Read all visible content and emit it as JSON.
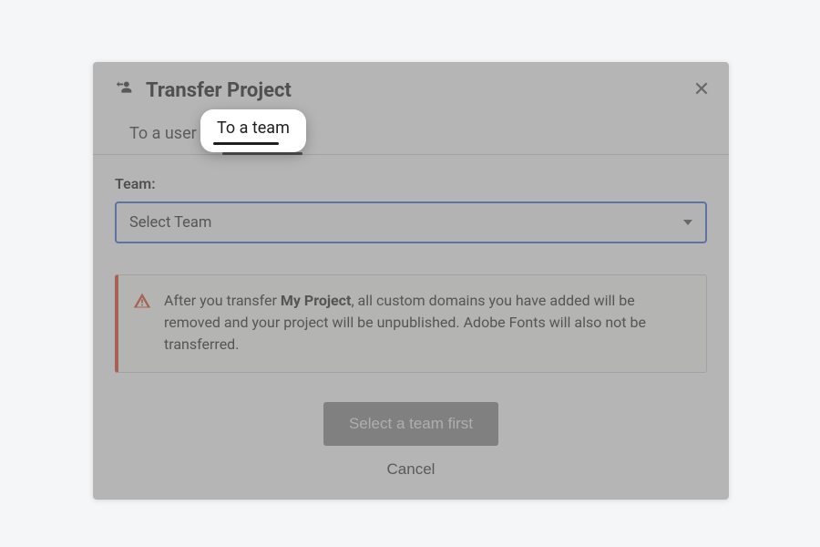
{
  "dialog": {
    "title": "Transfer Project",
    "tabs": {
      "user": "To a user",
      "team": "To a team"
    },
    "team_label": "Team:",
    "select_placeholder": "Select Team",
    "alert": {
      "prefix": "After you transfer ",
      "project_name": "My Project",
      "suffix": ", all custom domains you have added will be removed and your project will be unpublished. Adobe Fonts will also not be transferred."
    },
    "primary_button": "Select a team first",
    "cancel": "Cancel"
  },
  "highlight_label": "To a team"
}
